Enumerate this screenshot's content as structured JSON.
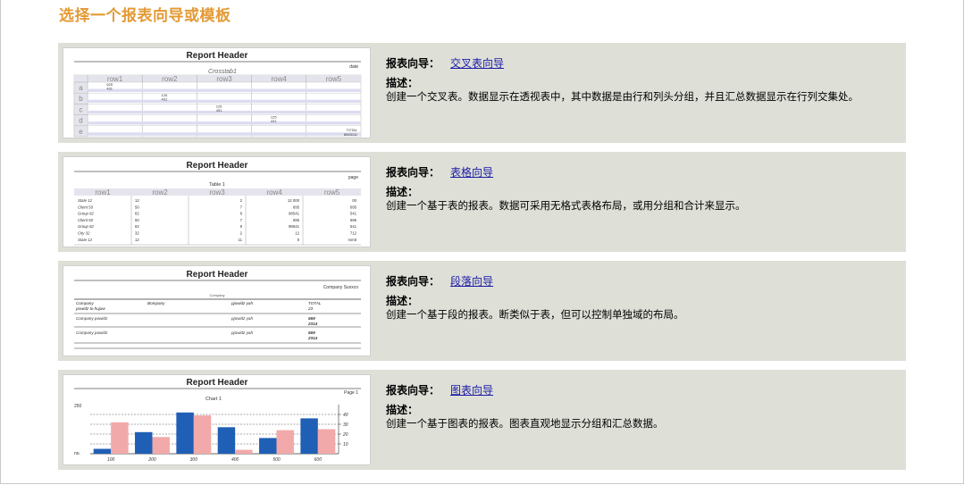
{
  "page": {
    "title": "选择一个报表向导或模板"
  },
  "cards": [
    {
      "wizard_label": "报表向导：",
      "wizard_link": "交叉表向导",
      "desc_label": "描述：",
      "desc": "创建一个交叉表。数据显示在透视表中，其中数据是由行和列头分组，并且汇总数据显示在行列交集处。",
      "thumb": {
        "header": "Report Header",
        "subtitle": "Crosstab1",
        "corner": "date",
        "cols": [
          "row1",
          "row2",
          "row3",
          "row4",
          "row5"
        ],
        "rows": [
          "a",
          "b",
          "c",
          "d",
          "e"
        ],
        "values": [
          "625",
          "431",
          "125",
          "431",
          "125",
          "431",
          "125",
          "431"
        ],
        "total": "TOTAL",
        "total_val": "8653111"
      }
    },
    {
      "wizard_label": "报表向导：",
      "wizard_link": "表格向导",
      "desc_label": "描述：",
      "desc": "创建一个基于表的报表。数据可采用无格式表格布局，或用分组和合计来显示。",
      "thumb": {
        "header": "Report Header",
        "subtitle": "Table 1",
        "corner": "page",
        "cols": [
          "row1",
          "row2",
          "row3",
          "row4",
          "row5"
        ],
        "rows": [
          [
            "State 12",
            "12",
            "2",
            "12 000",
            "00"
          ],
          [
            "Client 50",
            "50",
            "7",
            "695",
            "695"
          ],
          [
            "Group 82",
            "82",
            "8",
            "98541",
            "541"
          ],
          [
            "Client 50",
            "50",
            "7",
            "695",
            "695"
          ],
          [
            "Group 82",
            "82",
            "8",
            "98541",
            "541"
          ],
          [
            "City 32",
            "32",
            "2",
            "12",
            "712"
          ],
          [
            "State 12",
            "12",
            "11",
            "8",
            "mm8"
          ]
        ]
      }
    },
    {
      "wizard_label": "报表向导：",
      "wizard_link": "段落向导",
      "desc_label": "描述：",
      "desc": "创建一个基于段的报表。断类似于表，但可以控制单独域的布局。",
      "thumb": {
        "header": "Report Header",
        "corner": "Company Suxxco",
        "small": "Company",
        "headrow": [
          "Company",
          "Bompany",
          "pjowidz yah",
          "TOTAL"
        ],
        "headrow2": [
          "powidz to hujuw",
          "",
          "",
          "23"
        ],
        "rows": [
          [
            "Company powidz",
            "pjowidz yah",
            "569",
            "2314"
          ],
          [
            "Company powidz",
            "pjowidz yah",
            "569",
            "2314"
          ]
        ]
      }
    },
    {
      "wizard_label": "报表向导：",
      "wizard_link": "图表向导",
      "desc_label": "描述：",
      "desc": "创建一个基于图表的报表。图表直观地显示分组和汇总数据。",
      "thumb": {
        "header": "Report Header",
        "subtitle": "Chart 1",
        "corner": "Page 1",
        "ytop": "250",
        "ybottom": "no.",
        "xlabels": [
          "100",
          "200",
          "300",
          "400",
          "500",
          "600"
        ],
        "rticks": [
          "40",
          "30",
          "20",
          "10"
        ],
        "blue": [
          5,
          22,
          42,
          27,
          16,
          36
        ],
        "pink": [
          32,
          17,
          39,
          4,
          24,
          25
        ],
        "ymax": 50,
        "colors": {
          "blue": "#1f5fb5",
          "pink": "#f2a9a9"
        }
      }
    }
  ]
}
